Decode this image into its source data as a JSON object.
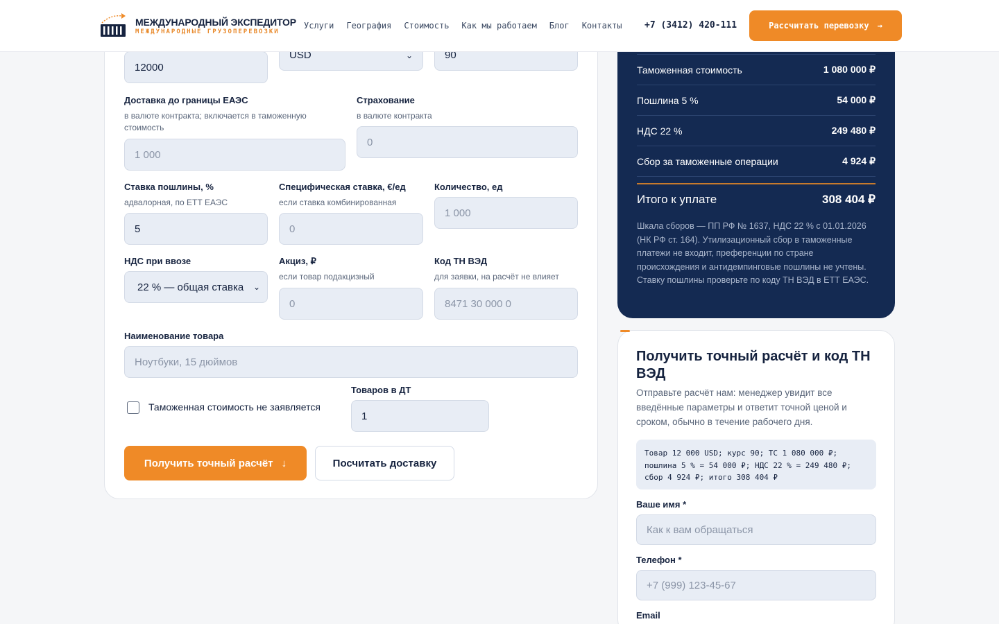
{
  "header": {
    "brand_name": "МЕЖДУНАРОДНЫЙ ЭКСПЕДИТОР",
    "brand_sub": "МЕЖДУНАРОДНЫЕ ГРУЗОПЕРЕВОЗКИ",
    "nav": [
      "Услуги",
      "География",
      "Стоимость",
      "Как мы работаем",
      "Блог",
      "Контакты"
    ],
    "phone": "+7 (3412) 420-111",
    "cta_label": "Рассчитать перевозку",
    "logo_icon": "container-truck-logo-icon",
    "accent_color": "#ef8a27"
  },
  "form": {
    "row0": {
      "value_input": "12000",
      "currency": "USD",
      "rate": "90"
    },
    "delivery": {
      "label": "Доставка до границы ЕАЭС",
      "hint": "в валюте контракта; включается в таможенную стоимость",
      "placeholder": "1 000"
    },
    "insurance": {
      "label": "Страхование",
      "hint": "в валюте контракта",
      "placeholder": "0"
    },
    "duty_rate": {
      "label": "Ставка пошлины, %",
      "hint": "адвалорная, по ЕТТ ЕАЭС",
      "value": "5"
    },
    "specific_rate": {
      "label": "Специфическая ставка, €/ед",
      "hint": "если ставка комбинированная",
      "placeholder": "0"
    },
    "quantity": {
      "label": "Количество, ед",
      "placeholder": "1 000"
    },
    "vat": {
      "label": "НДС при ввозе",
      "value": "22 % — общая ставка"
    },
    "excise": {
      "label": "Акциз, ₽",
      "hint": "если товар подакцизный",
      "placeholder": "0"
    },
    "hs_code": {
      "label": "Код ТН ВЭД",
      "hint": "для заявки, на расчёт не влияет",
      "placeholder": "8471 30 000 0"
    },
    "product_name": {
      "label": "Наименование товара",
      "placeholder": "Ноутбуки, 15 дюймов"
    },
    "no_customs_value": {
      "label": "Таможенная стоимость не заявляется",
      "checked": false
    },
    "items_in_dt": {
      "label": "Товаров в ДТ",
      "value": "1"
    },
    "btn_exact": "Получить точный расчёт",
    "btn_delivery": "Посчитать доставку"
  },
  "summary": {
    "rows": [
      {
        "label": "Таможенная стоимость",
        "value": "1 080 000 ₽"
      },
      {
        "label": "Пошлина 5 %",
        "value": "54 000 ₽"
      },
      {
        "label": "НДС 22 %",
        "value": "249 480 ₽"
      },
      {
        "label": "Сбор за таможенные операции",
        "value": "4 924 ₽"
      }
    ],
    "total_label": "Итого к уплате",
    "total_value": "308 404 ₽",
    "note": "Шкала сборов — ПП РФ № 1637, НДС 22 % с 01.01.2026 (НК РФ ст. 164). Утилизационный сбор в таможенные платежи не входит, преференции по стране происхождения и антидемпинговые пошлины не учтены. Ставку пошлины проверьте по коду ТН ВЭД в ЕТТ ЕАЭС."
  },
  "request": {
    "title": "Получить точный расчёт и код ТН ВЭД",
    "text": "Отправьте расчёт нам: менеджер увидит все введённые параметры и ответит точной ценой и сроком, обычно в течение рабочего дня.",
    "code_lines": [
      "Товар 12 000 USD; курс 90; ТС 1 080 000 ₽;",
      "пошлина 5 % = 54 000 ₽; НДС 22 % = 249 480 ₽;",
      "сбор 4 924 ₽; итого 308 404 ₽"
    ],
    "name_label": "Ваше имя *",
    "name_placeholder": "Как к вам обращаться",
    "phone_label": "Телефон *",
    "phone_placeholder": "+7 (999) 123-45-67",
    "email_label": "Email"
  }
}
